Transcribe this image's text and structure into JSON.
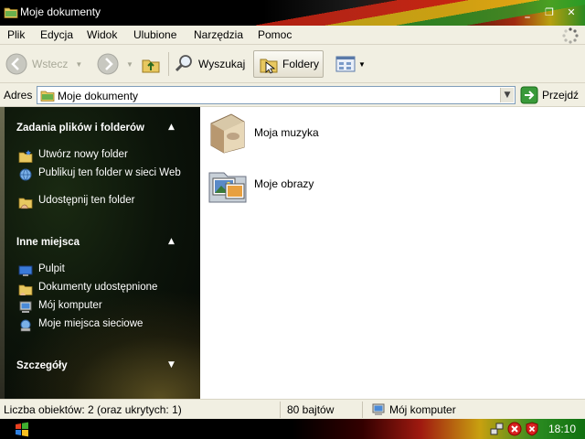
{
  "window": {
    "title": "Moje dokumenty",
    "controls": {
      "minimize": "_",
      "maximize": "❐",
      "close": "✕"
    }
  },
  "menu": [
    "Plik",
    "Edycja",
    "Widok",
    "Ulubione",
    "Narzędzia",
    "Pomoc"
  ],
  "toolbar": {
    "back": "Wstecz",
    "search": "Wyszukaj",
    "folders": "Foldery"
  },
  "address": {
    "label": "Adres",
    "value": "Moje dokumenty",
    "go": "Przejdź"
  },
  "taskpane": {
    "sections": [
      {
        "title": "Zadania plików i folderów",
        "items": [
          {
            "label": "Utwórz nowy folder",
            "icon": "new-folder-icon"
          },
          {
            "label": "Publikuj ten folder w sieci Web",
            "icon": "publish-web-icon"
          },
          {
            "label": "Udostępnij ten folder",
            "icon": "share-folder-icon"
          }
        ]
      },
      {
        "title": "Inne miejsca",
        "items": [
          {
            "label": "Pulpit",
            "icon": "desktop-icon"
          },
          {
            "label": "Dokumenty udostępnione",
            "icon": "shared-documents-icon"
          },
          {
            "label": "Mój komputer",
            "icon": "my-computer-icon"
          },
          {
            "label": "Moje miejsca sieciowe",
            "icon": "network-places-icon"
          }
        ]
      },
      {
        "title": "Szczegóły",
        "items": []
      }
    ]
  },
  "content": {
    "items": [
      {
        "label": "Moja muzyka",
        "icon": "music-folder-icon"
      },
      {
        "label": "Moje obrazy",
        "icon": "pictures-folder-icon"
      }
    ]
  },
  "status": {
    "objects": "Liczba obiektów: 2 (oraz ukrytych: 1)",
    "size": "80 bajtów",
    "location": "Mój komputer"
  },
  "taskbar": {
    "clock": "18:10"
  }
}
